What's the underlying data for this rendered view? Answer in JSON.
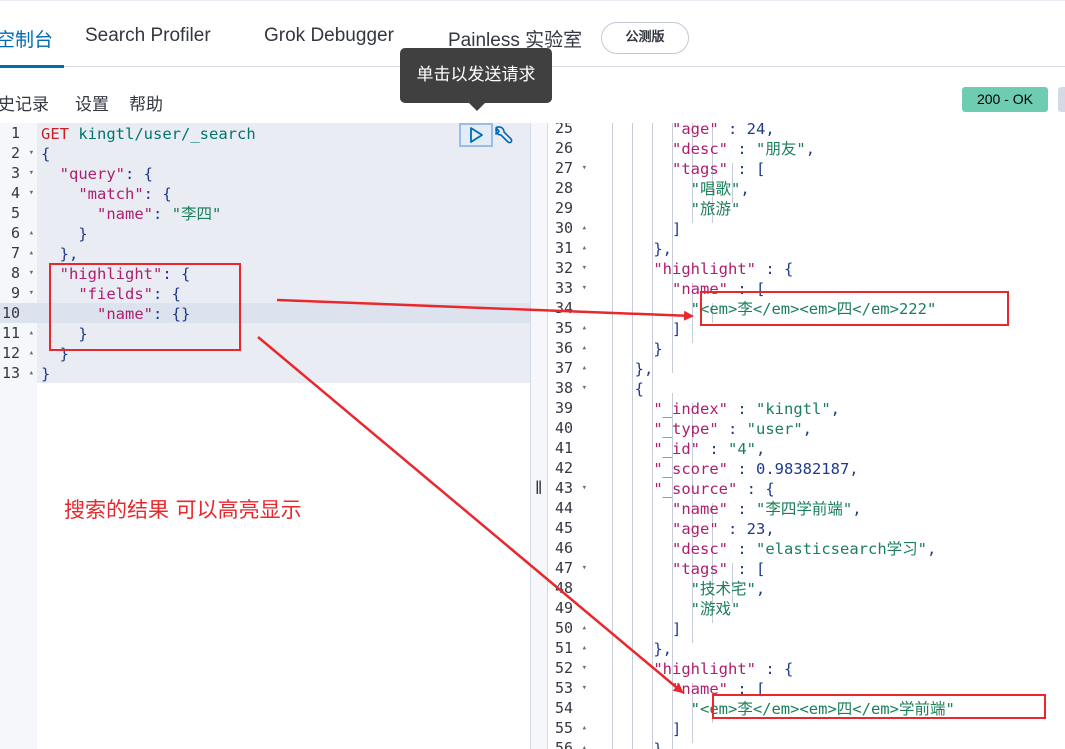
{
  "tabs": [
    {
      "label": "控制台",
      "display": "空制台"
    },
    {
      "label": "Search Profiler"
    },
    {
      "label": "Grok Debugger"
    },
    {
      "label": "Painless 实验室"
    }
  ],
  "beta_badge": "公测版",
  "menu": {
    "history": "历史记录",
    "history_display": "史记录",
    "settings": "设置",
    "help": "帮助"
  },
  "tooltip": "单击以发送请求",
  "status": "200 - OK",
  "request_lines": [
    "GET kingtl/user/_search",
    "{",
    "  \"query\": {",
    "    \"match\": {",
    "      \"name\": \"李四\"",
    "    }",
    "  },",
    "  \"highlight\": {",
    "    \"fields\": {",
    "      \"name\": {}",
    "    }",
    "  }",
    "}"
  ],
  "request_line_numbers": [
    "1",
    "2",
    "3",
    "4",
    "5",
    "6",
    "7",
    "8",
    "9",
    "10",
    "11",
    "12",
    "13"
  ],
  "output_line_numbers": [
    "25",
    "26",
    "27",
    "28",
    "29",
    "30",
    "31",
    "32",
    "33",
    "34",
    "35",
    "36",
    "37",
    "38",
    "39",
    "40",
    "41",
    "42",
    "43",
    "44",
    "45",
    "46",
    "47",
    "48",
    "49",
    "50",
    "51",
    "52",
    "53",
    "54",
    "55",
    "56"
  ],
  "output_lines": [
    "          \"age\" : 24,",
    "          \"desc\" : \"朋友\",",
    "          \"tags\" : [",
    "            \"唱歌\",",
    "            \"旅游\"",
    "          ]",
    "        },",
    "        \"highlight\" : {",
    "          \"name\" : [",
    "            \"<em>李</em><em>四</em>222\"",
    "          ]",
    "        }",
    "      },",
    "      {",
    "        \"_index\" : \"kingtl\",",
    "        \"_type\" : \"user\",",
    "        \"_id\" : \"4\",",
    "        \"_score\" : 0.98382187,",
    "        \"_source\" : {",
    "          \"name\" : \"李四学前端\",",
    "          \"age\" : 23,",
    "          \"desc\" : \"elasticsearch学习\",",
    "          \"tags\" : [",
    "            \"技术宅\",",
    "            \"游戏\"",
    "          ]",
    "        },",
    "        \"highlight\" : {",
    "          \"name\" : [",
    "            \"<em>李</em><em>四</em>学前端\"",
    "          ]",
    "        }"
  ],
  "annotation": "搜索的结果 可以高亮显示",
  "colors": {
    "accent": "#006bb4",
    "status_bg": "#6dccb1",
    "annotation_red": "#e8282d",
    "json_key": "#1f3a8a",
    "json_string": "#1a7f5a",
    "http_method": "#c61e25"
  },
  "icons": {
    "play": "play-icon",
    "wrench": "wrench-icon"
  }
}
